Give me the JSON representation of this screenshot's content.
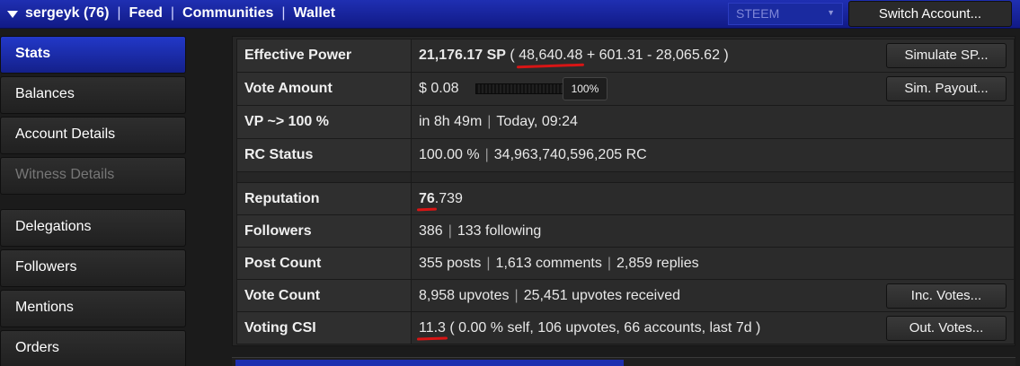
{
  "topbar": {
    "user": "sergeyk (76)",
    "links": [
      "Feed",
      "Communities",
      "Wallet"
    ],
    "chain_select": "STEEM",
    "switch_account": "Switch Account..."
  },
  "sidebar": {
    "items": [
      {
        "label": "Stats",
        "state": "active"
      },
      {
        "label": "Balances"
      },
      {
        "label": "Account Details"
      },
      {
        "label": "Witness Details",
        "state": "disabled"
      },
      {
        "label": "Delegations"
      },
      {
        "label": "Followers"
      },
      {
        "label": "Mentions"
      },
      {
        "label": "Orders"
      }
    ]
  },
  "stats": {
    "effective_power": {
      "label": "Effective Power",
      "sp": "21,176.17 SP",
      "open": "(",
      "own": "48,640.48",
      "rest": "+ 601.31 - 28,065.62 )",
      "button": "Simulate SP..."
    },
    "vote_amount": {
      "label": "Vote Amount",
      "value": "$ 0.08",
      "percent": "100%",
      "button": "Sim. Payout..."
    },
    "vp": {
      "label": "VP ~> 100 %",
      "time": "in 8h 49m",
      "when": "Today, 09:24"
    },
    "rc": {
      "label": "RC Status",
      "percent": "100.00 %",
      "value": "34,963,740,596,205 RC"
    },
    "reputation": {
      "label": "Reputation",
      "major": "76",
      "minor": ".739"
    },
    "followers": {
      "label": "Followers",
      "count": "386",
      "following": "133 following"
    },
    "post_count": {
      "label": "Post Count",
      "posts": "355 posts",
      "comments": "1,613 comments",
      "replies": "2,859 replies"
    },
    "vote_count": {
      "label": "Vote Count",
      "upvotes": "8,958 upvotes",
      "received": "25,451 upvotes received",
      "button": "Inc. Votes..."
    },
    "voting_csi": {
      "label": "Voting CSI",
      "value": "11.3",
      "details": "( 0.00 % self, 106 upvotes, 66 accounts, last 7d )",
      "button": "Out. Votes..."
    }
  },
  "colors": {
    "accent": "#1a2aa8",
    "annotation": "#d71515"
  }
}
